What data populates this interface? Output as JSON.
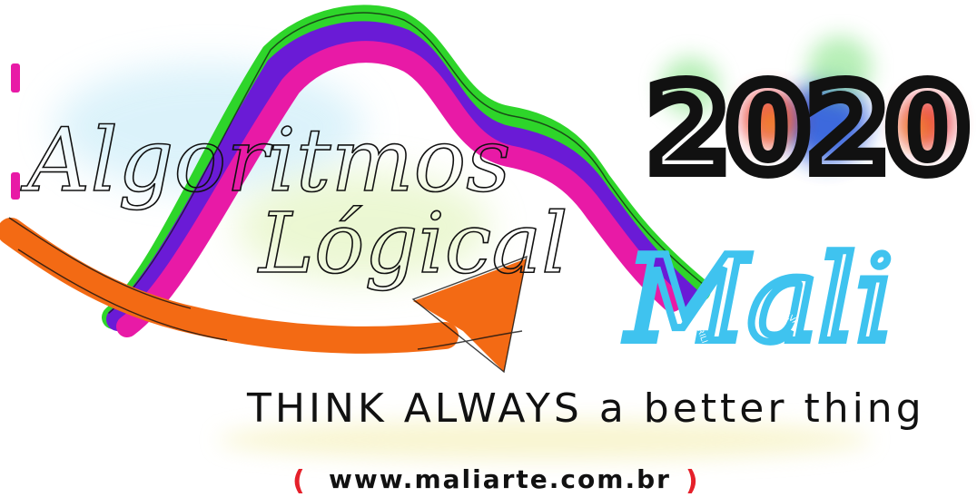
{
  "texts": {
    "algoritmos": "Algoritmos",
    "logical": "Lógical",
    "year": "2020",
    "signature": "Mali",
    "signature_small_1": "MARILIA",
    "signature_small_2": "SILVA",
    "tagline": "THINK ALWAYS a better thing",
    "url_open": "(",
    "url": "www.maliarte.com.br",
    "url_close": ")"
  },
  "colors": {
    "green": "#2ed52a",
    "purple": "#6a1bd6",
    "magenta": "#e81aa6",
    "orange": "#f36a14",
    "cyan": "#3fc3ef",
    "black": "#111111",
    "red": "#e5202a",
    "blue_glow": "#1e4fd8",
    "green_glow": "#7be27b",
    "yellow_glow": "#f4e98a"
  },
  "icons": {
    "swoosh": "colored-wave-strokes",
    "arrow": "orange-arrow",
    "digit_glows": "colored-glow-blobs"
  }
}
